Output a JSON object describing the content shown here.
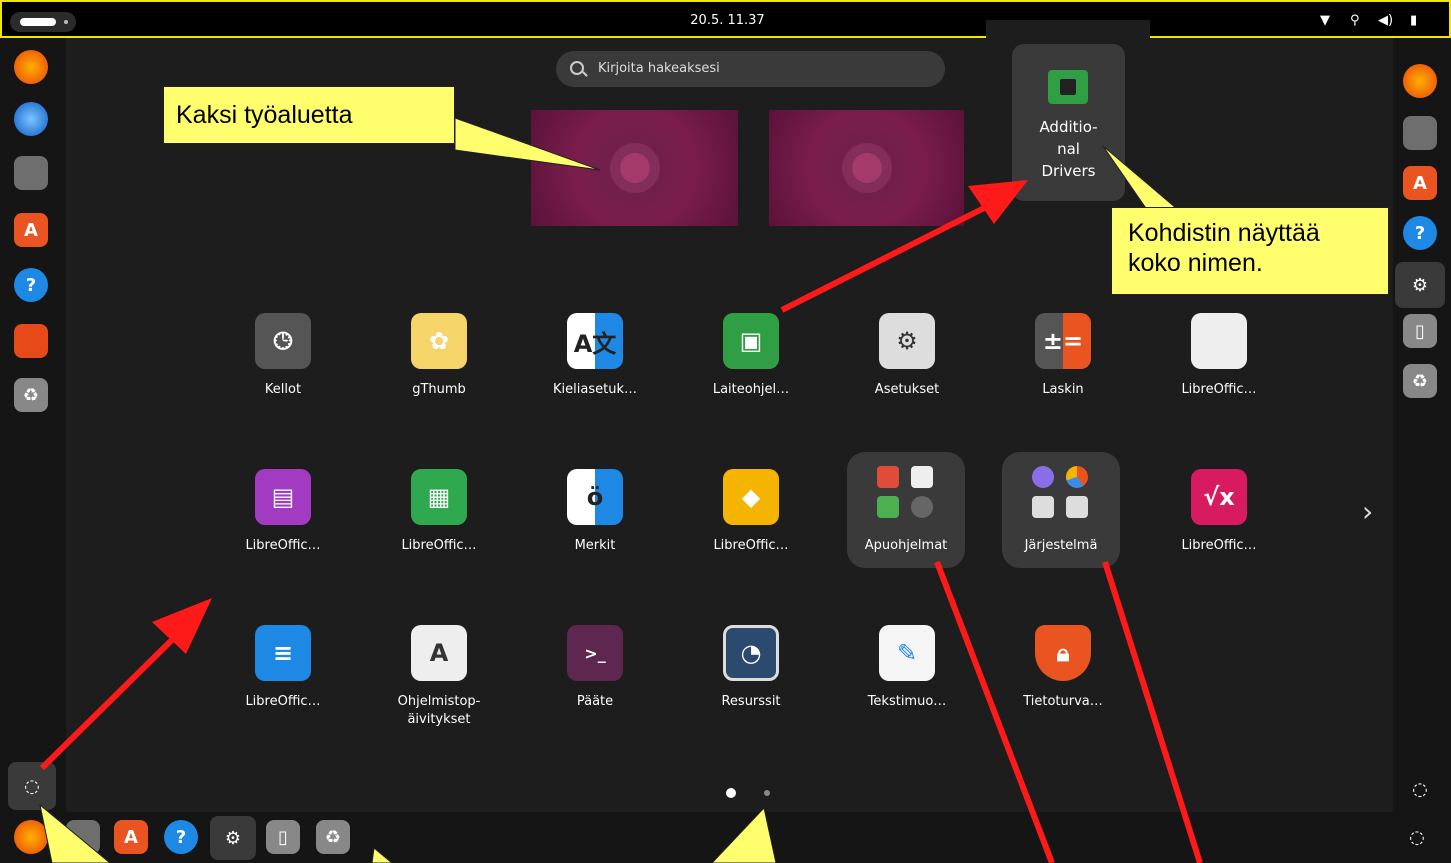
{
  "topbar": {
    "clock": "20.5.  11.37",
    "status_icons": [
      "wifi-icon",
      "mic-muted-icon",
      "speaker-icon",
      "battery-icon"
    ]
  },
  "search": {
    "placeholder": "Kirjoita hakeaksesi"
  },
  "tooltip": {
    "name": "Additio-\nnal\nDrivers"
  },
  "apps": {
    "row1": [
      "Kellot",
      "gThumb",
      "Kieliasetuk…",
      "Laiteohjel…",
      "Asetukset",
      "Laskin",
      "LibreOffic…"
    ],
    "row2": [
      "LibreOffic…",
      "LibreOffic…",
      "Merkit",
      "LibreOffic…",
      "Apuohjelmat",
      "Järjestelmä",
      "LibreOffic…"
    ],
    "row3": [
      "LibreOffic…",
      "Ohjelmistop-\näivitykset",
      "Pääte",
      "Resurssit",
      "Tekstimuo…",
      "Tietoturva…"
    ]
  },
  "callouts": {
    "workspaces": "Kaksi työaluetta",
    "cursor": "Kohdistin näyttää\nkoko nimen."
  },
  "colors": {
    "callout_bg": "#ffff6e",
    "arrow": "#ff1a1a",
    "accent": "#e95420"
  }
}
